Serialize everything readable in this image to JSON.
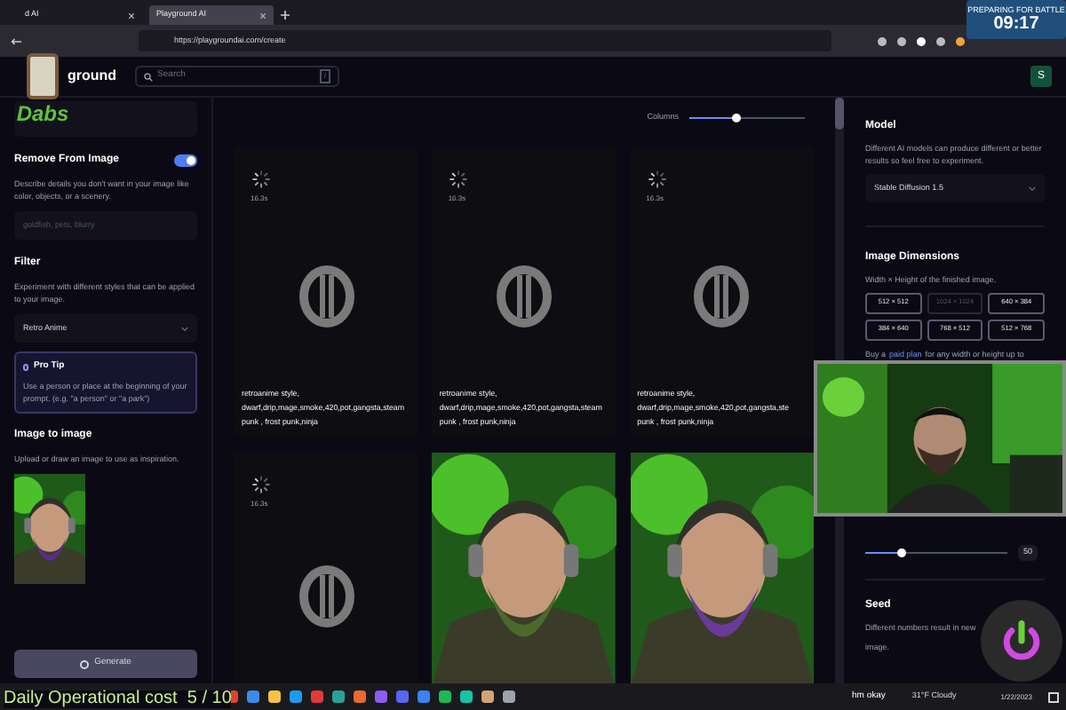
{
  "browser": {
    "tabs": [
      {
        "title": "d AI",
        "selected": false
      },
      {
        "title": "Playground AI",
        "selected": true
      }
    ],
    "url": "https://playgroundai.com/create"
  },
  "header": {
    "brand": "ground",
    "search": {
      "placeholder": "Search",
      "shortcut": "/"
    },
    "avatar": "S"
  },
  "left_panel": {
    "remove": {
      "title": "Remove From Image",
      "on": true,
      "description": "Describe details you don't want in your image like color, objects, or a scenery.",
      "placeholder": "goldfish, pets, blurry"
    },
    "filter": {
      "title": "Filter",
      "description": "Experiment with different styles that can be applied to your image.",
      "value": "Retro Anime"
    },
    "pro_tip": {
      "title": "Pro Tip",
      "text": "Use a person or place at the beginning of your prompt. (e.g. \"a person\" or \"a park\")"
    },
    "image_to_image": {
      "title": "Image to image",
      "description": "Upload or draw an image to use as inspiration."
    },
    "generate": "Generate"
  },
  "grid": {
    "columns": {
      "label": "Columns",
      "level": 0.4
    },
    "cards": [
      {
        "kind": "loading",
        "time": "16.3s",
        "prompt": [
          "retroanime style,",
          "dwarf,drip,mage,smoke,420,pot,gangsta,steam",
          "punk , frost punk,ninja"
        ]
      },
      {
        "kind": "loading",
        "time": "16.3s",
        "prompt": [
          "retroanime style,",
          "dwarf,drip,mage,smoke,420,pot,gangsta,steam",
          "punk , frost punk,ninja"
        ]
      },
      {
        "kind": "loading",
        "time": "16.3s",
        "prompt": [
          "retroanime style,",
          "dwarf,drip,mage,smoke,420,pot,gangsta,ste",
          "punk , frost punk,ninja"
        ]
      },
      {
        "kind": "loading",
        "time": "16.3s"
      },
      {
        "kind": "picture"
      },
      {
        "kind": "picture"
      }
    ]
  },
  "right_panel": {
    "model": {
      "title": "Model",
      "description": "Different AI models can produce different or better results so feel free to experiment.",
      "value": "Stable Diffusion 1.5"
    },
    "dimensions": {
      "title": "Image Dimensions",
      "description": "Width × Height of the finished image.",
      "options": [
        {
          "label": "512 × 512",
          "disabled": false
        },
        {
          "label": "1024 × 1024",
          "disabled": true
        },
        {
          "label": "640 × 384",
          "disabled": false
        },
        {
          "label": "384 × 640",
          "disabled": false
        },
        {
          "label": "768 × 512",
          "disabled": false
        },
        {
          "label": "512 × 768",
          "disabled": false
        }
      ],
      "note_before": "Buy a",
      "note_link": "paid plan",
      "note_after": "for any width or height up to"
    },
    "steps": {
      "level": 0.25,
      "reading": "50"
    },
    "seed": {
      "title": "Seed",
      "description": [
        "Different numbers result in new",
        "image."
      ]
    }
  },
  "overlays": {
    "logo": "Dabs",
    "clock": "09:17",
    "banner": "PREPARING FOR BATTLE",
    "cost": "Daily Operational cost  5 / 10"
  },
  "taskbar": {
    "chat": "hm okay",
    "weather": "31°F Cloudy",
    "date": "1/22/2023"
  }
}
